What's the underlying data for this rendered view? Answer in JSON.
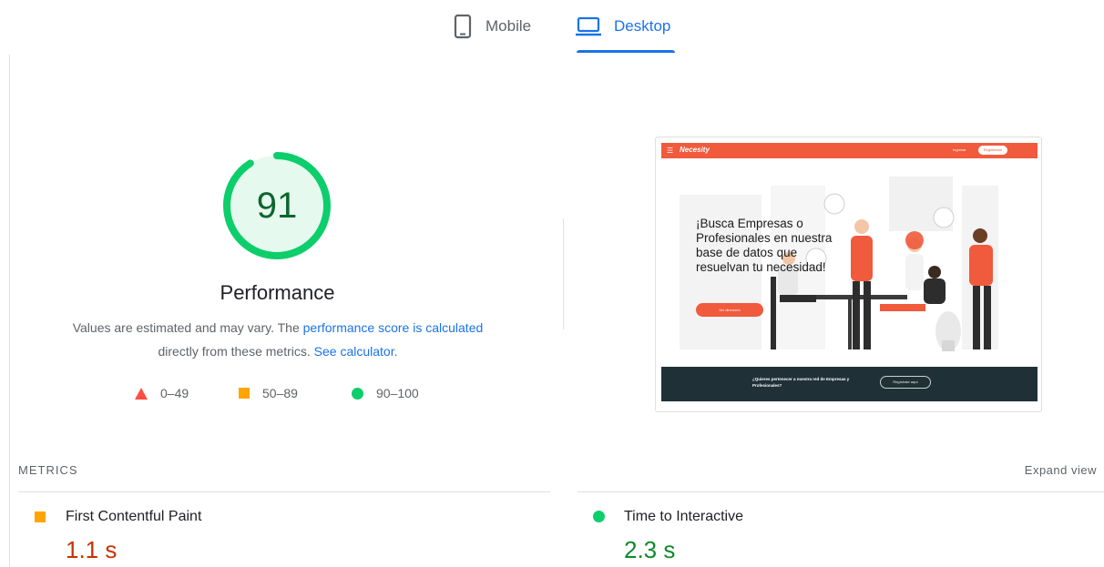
{
  "tabs": [
    {
      "label": "Mobile",
      "icon": "smartphone-icon",
      "active": false
    },
    {
      "label": "Desktop",
      "icon": "laptop-icon",
      "active": true
    }
  ],
  "performance": {
    "score": "91",
    "score_value": 91,
    "title": "Performance",
    "desc_prefix": "Values are estimated and may vary. The ",
    "desc_link1": "performance score is calculated",
    "desc_middle": " directly from these metrics. ",
    "desc_link2": "See calculator."
  },
  "legend": [
    {
      "range": "0–49",
      "icon": "red-triangle-icon",
      "color": "#ff4e42"
    },
    {
      "range": "50–89",
      "icon": "orange-square-icon",
      "color": "#ffa400"
    },
    {
      "range": "90–100",
      "icon": "green-circle-icon",
      "color": "#0cce6b"
    }
  ],
  "screenshot": {
    "logo": "Necesity",
    "login": "Ingresar",
    "register": "Registrarse",
    "heading": "¡Busca Empresas o Profesionales en nuestra base de datos que resuelvan tu necesidad!",
    "cta": "Ver directorio",
    "footer_text": "¿Quieres pertenecer a nuestra red de Empresas y Profesionales?",
    "footer_button": "Regístrate aquí"
  },
  "metrics": {
    "title": "METRICS",
    "expand_label": "Expand view",
    "items": [
      {
        "label": "First Contentful Paint",
        "value": "1.1 s",
        "status": "average"
      },
      {
        "label": "Time to Interactive",
        "value": "2.3 s",
        "status": "pass"
      }
    ]
  },
  "colors": {
    "accent": "#1a73e8",
    "pass": "#0cce6b",
    "average": "#ffa400",
    "fail": "#ff4e42",
    "brand": "#f05a3d"
  }
}
